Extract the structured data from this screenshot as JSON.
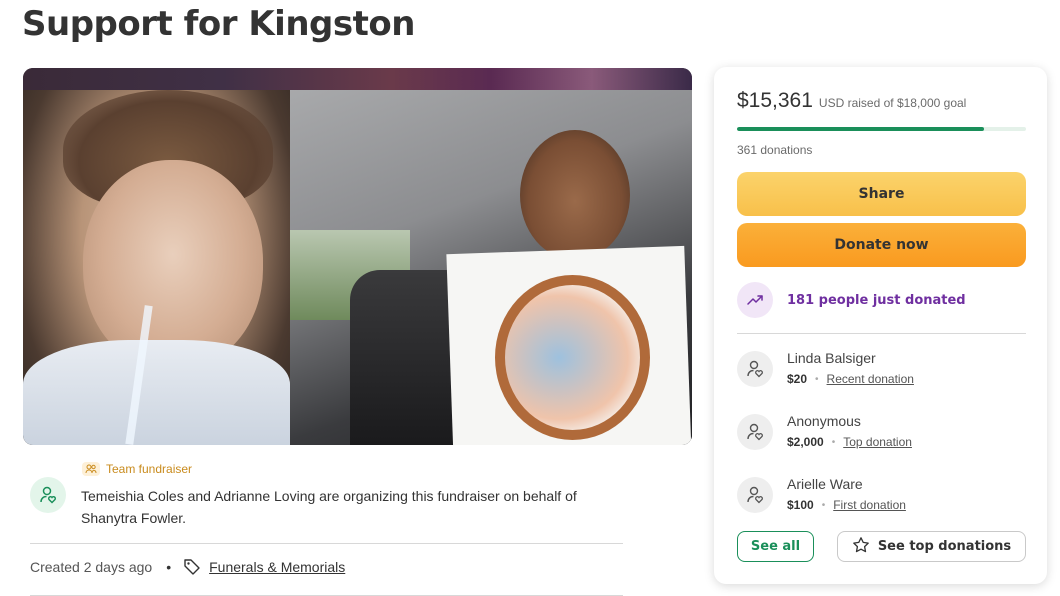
{
  "page": {
    "title": "Support for Kingston"
  },
  "organizer": {
    "tag_label": "Team fundraiser",
    "text": "Temeishia Coles and Adrianne Loving are organizing this fundraiser on behalf of Shanytra Fowler."
  },
  "meta": {
    "created": "Created 2 days ago",
    "separator": "•",
    "category": "Funerals & Memorials"
  },
  "donation": {
    "raised_amount": "$15,361",
    "goal_text": "USD raised of $18,000 goal",
    "progress_fraction": 0.853,
    "donations_count": "361 donations",
    "share_label": "Share",
    "donate_label": "Donate now",
    "just_donated": "181 people just donated",
    "donors": [
      {
        "name": "Linda Balsiger",
        "amount": "$20",
        "bullet": "•",
        "type": "Recent donation"
      },
      {
        "name": "Anonymous",
        "amount": "$2,000",
        "bullet": "•",
        "type": "Top donation"
      },
      {
        "name": "Arielle Ware",
        "amount": "$100",
        "bullet": "•",
        "type": "First donation"
      }
    ],
    "see_all_label": "See all",
    "see_top_label": "See top donations"
  },
  "colors": {
    "accent_green": "#1a8f5a",
    "share_yellow": "#f8c04a",
    "donate_orange": "#f99a1f",
    "trend_purple": "#6f2fa0"
  }
}
